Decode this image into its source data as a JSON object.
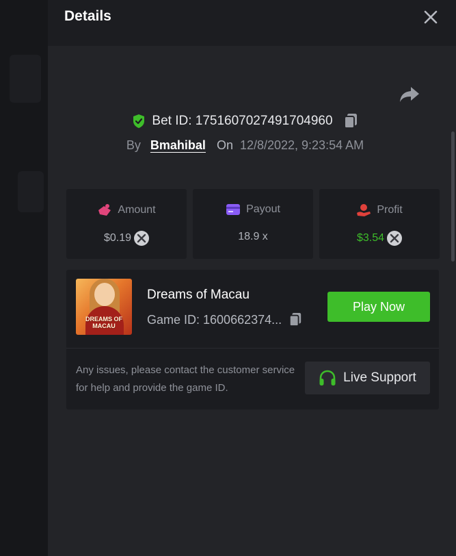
{
  "modal": {
    "title": "Details"
  },
  "bet": {
    "id_text": "Bet ID: 1751607027491704960",
    "by_label": "By",
    "user": "Bmahibal",
    "on_label": "On",
    "datetime": "12/8/2022, 9:23:54 AM"
  },
  "stats": [
    {
      "label": "Amount",
      "value": "$0.19",
      "icon": "amount-icon",
      "color": "#b0b3ba"
    },
    {
      "label": "Payout",
      "value": "18.9 x",
      "icon": "payout-icon",
      "color": "#b0b3ba"
    },
    {
      "label": "Profit",
      "value": "$3.54",
      "icon": "profit-icon",
      "color": "#3ebd2a"
    }
  ],
  "game": {
    "name": "Dreams of Macau",
    "id_text": "Game ID: 1600662374...",
    "thumb_text": "DREAMS OF MACAU",
    "play_label": "Play Now",
    "issue_text": "Any issues, please contact the customer service for help and provide the game ID.",
    "support_label": "Live Support"
  },
  "colors": {
    "accent_green": "#3ebd2a",
    "amount_pink": "#e0457b",
    "payout_purple": "#8a5cf6",
    "profit_red": "#e0413b"
  }
}
